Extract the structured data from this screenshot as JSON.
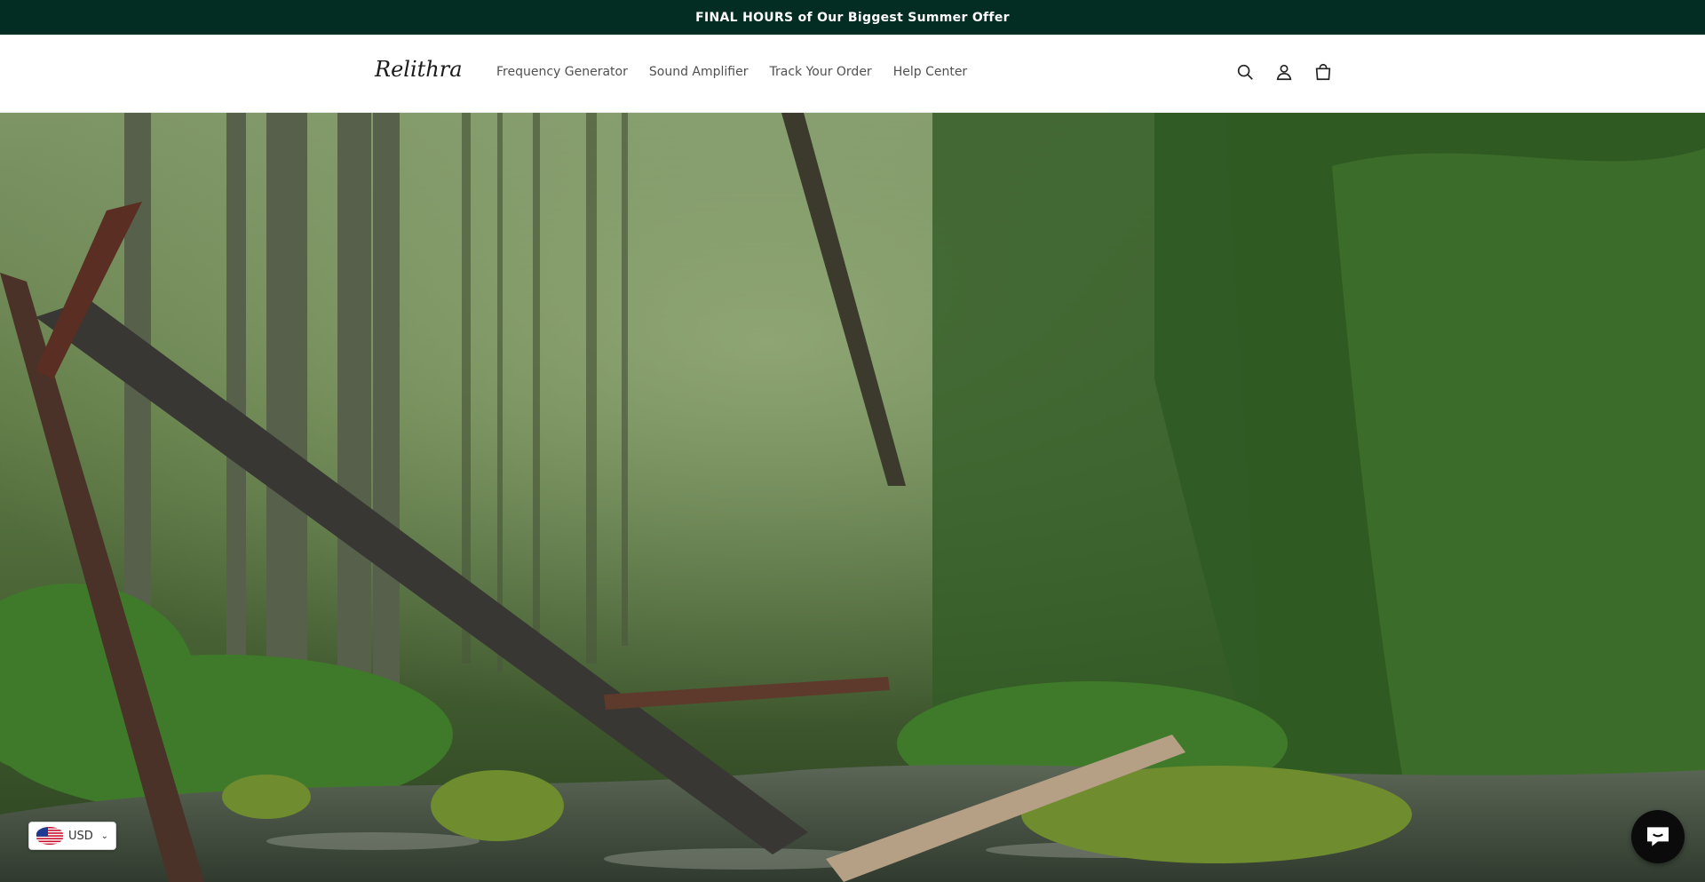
{
  "announcement": {
    "text": "FINAL HOURS of Our Biggest Summer Offer"
  },
  "header": {
    "logo": "Relithra",
    "nav": [
      "Frequency Generator",
      "Sound Amplifier",
      "Track Your Order",
      "Help Center"
    ],
    "icons": [
      "search-icon",
      "account-icon",
      "cart-icon"
    ]
  },
  "hero": {
    "image": "forest-stream-with-fallen-trees"
  },
  "currency_selector": {
    "value": "USD",
    "flag": "us-flag-icon"
  },
  "chat_widget": {
    "icon": "chat-icon"
  },
  "colors": {
    "announcement_bg": "#032c22",
    "header_bg": "#ffffff",
    "chat_bg": "#0b0b0b"
  }
}
